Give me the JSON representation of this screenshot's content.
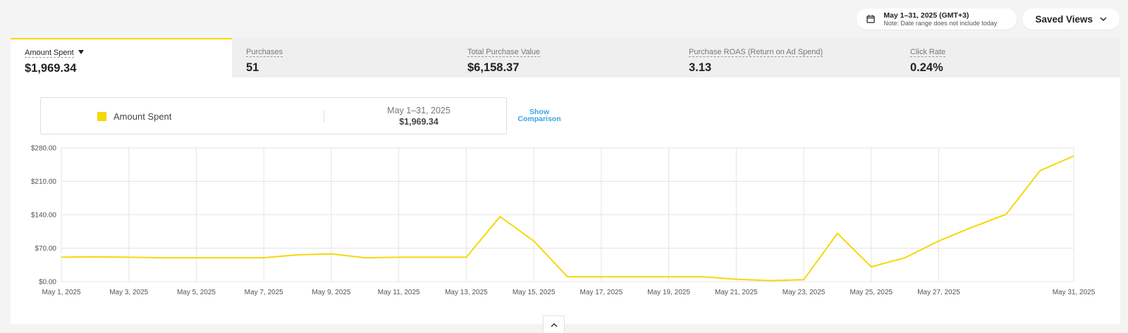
{
  "header": {
    "date_range": "May 1–31, 2025 (GMT+3)",
    "date_note": "Note: Date range does not include today",
    "saved_views_label": "Saved Views"
  },
  "tabs": [
    {
      "label": "Amount Spent",
      "value": "$1,969.34"
    },
    {
      "label": "Purchases",
      "value": "51"
    },
    {
      "label": "Total Purchase Value",
      "value": "$6,158.37"
    },
    {
      "label": "Purchase ROAS (Return on Ad Spend)",
      "value": "3.13"
    },
    {
      "label": "Click Rate",
      "value": "0.24%"
    }
  ],
  "legend": {
    "series_name": "Amount Spent",
    "period": "May 1–31, 2025",
    "total": "$1,969.34",
    "show_comparison": "Show Comparison"
  },
  "colors": {
    "accent": "#f5d80a",
    "link": "#3aa3e3"
  },
  "icons": {
    "date_pill": "calendar-icon",
    "saved_views": "chevron-down-icon",
    "metric_menu": "caret-down-icon",
    "bottom_toggle": "chevron-up-icon"
  },
  "chart_data": {
    "type": "line",
    "x": [
      "May 1, 2025",
      "May 2, 2025",
      "May 3, 2025",
      "May 4, 2025",
      "May 5, 2025",
      "May 6, 2025",
      "May 7, 2025",
      "May 8, 2025",
      "May 9, 2025",
      "May 10, 2025",
      "May 11, 2025",
      "May 12, 2025",
      "May 13, 2025",
      "May 14, 2025",
      "May 15, 2025",
      "May 16, 2025",
      "May 17, 2025",
      "May 18, 2025",
      "May 19, 2025",
      "May 20, 2025",
      "May 21, 2025",
      "May 22, 2025",
      "May 23, 2025",
      "May 24, 2025",
      "May 25, 2025",
      "May 26, 2025",
      "May 27, 2025",
      "May 28, 2025",
      "May 29, 2025",
      "May 30, 2025",
      "May 31, 2025"
    ],
    "xticks": [
      "May 1, 2025",
      "May 3, 2025",
      "May 5, 2025",
      "May 7, 2025",
      "May 9, 2025",
      "May 11, 2025",
      "May 13, 2025",
      "May 15, 2025",
      "May 17, 2025",
      "May 19, 2025",
      "May 21, 2025",
      "May 23, 2025",
      "May 25, 2025",
      "May 27, 2025",
      "May 31, 2025"
    ],
    "series": [
      {
        "name": "Amount Spent",
        "color": "#f5d80a",
        "values": [
          51,
          52,
          51,
          50,
          50,
          50,
          50,
          56,
          58,
          50,
          51,
          51,
          51,
          136,
          85,
          10,
          10,
          10,
          10,
          10,
          5,
          2,
          4,
          101,
          31,
          50,
          85,
          114,
          141,
          232,
          263
        ]
      }
    ],
    "yticks": [
      "$0.00",
      "$70.00",
      "$140.00",
      "$210.00",
      "$280.00"
    ],
    "ytick_values": [
      0,
      70,
      140,
      210,
      280
    ],
    "ylim": [
      0,
      280
    ],
    "grid": true
  }
}
